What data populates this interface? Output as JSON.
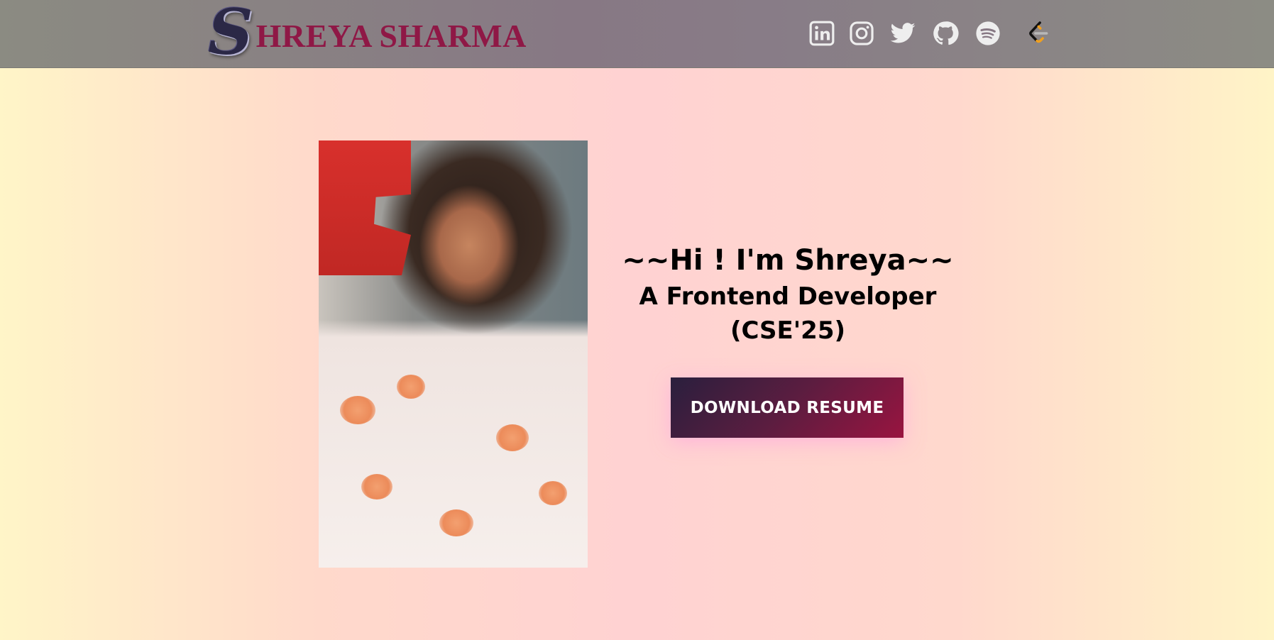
{
  "header": {
    "logo_letter": "S",
    "logo_text": "HREYA SHARMA",
    "social_links": [
      {
        "icon": "linkedin-icon"
      },
      {
        "icon": "instagram-icon"
      },
      {
        "icon": "twitter-icon"
      },
      {
        "icon": "github-icon"
      },
      {
        "icon": "spotify-icon"
      },
      {
        "icon": "leetcode-icon"
      }
    ]
  },
  "hero": {
    "title": "~~Hi ! I'm Shreya~~",
    "subtitle": "A Frontend Developer",
    "batch": "(CSE'25)",
    "resume_button": "DOWNLOAD RESUME"
  },
  "colors": {
    "brand": "#8f1846",
    "button_start": "#2a1f3d",
    "button_end": "#991440",
    "icon": "#eeeeee"
  }
}
